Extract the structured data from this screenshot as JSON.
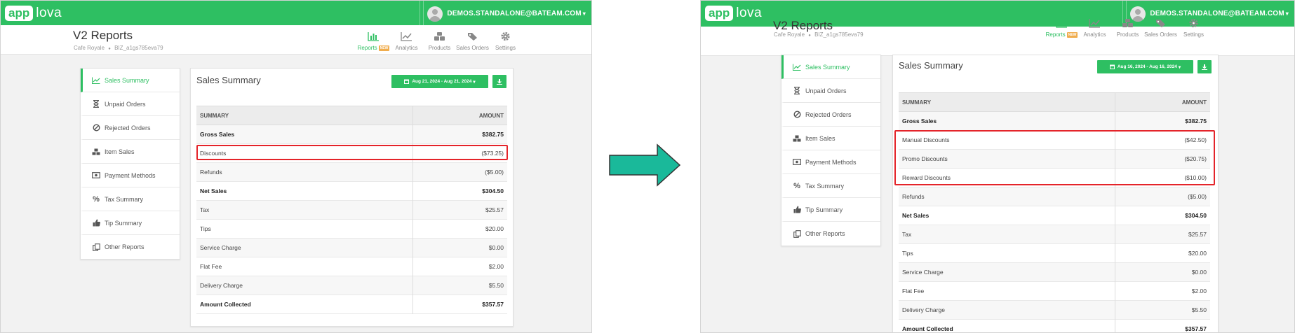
{
  "colors": {
    "brand": "#2ebf62",
    "highlight": "#e4242a",
    "arrow": "#1ab99a"
  },
  "app": {
    "logo_part1": "app",
    "logo_part2": "lova",
    "user_email": "DEMOS.STANDALONE@BATEAM.COM"
  },
  "header": {
    "title": "V2 Reports",
    "store": "Cafe Royale",
    "store_id": "BIZ_a1gs785eva79",
    "bullet": "●"
  },
  "nav": [
    {
      "label": "Reports",
      "badge": "NEW",
      "icon": "bar-chart-icon"
    },
    {
      "label": "Analytics",
      "icon": "line-chart-icon"
    },
    {
      "label": "Products",
      "icon": "cubes-icon"
    },
    {
      "label": "Sales Orders",
      "icon": "tags-icon"
    },
    {
      "label": "Settings",
      "icon": "gear-icon"
    }
  ],
  "sidebar": [
    {
      "label": "Sales Summary",
      "icon": "line-chart-icon"
    },
    {
      "label": "Unpaid Orders",
      "icon": "hourglass-icon"
    },
    {
      "label": "Rejected Orders",
      "icon": "ban-icon"
    },
    {
      "label": "Item Sales",
      "icon": "cubes-icon"
    },
    {
      "label": "Payment Methods",
      "icon": "money-icon"
    },
    {
      "label": "Tax Summary",
      "icon": "percent-icon"
    },
    {
      "label": "Tip Summary",
      "icon": "thumbs-up-icon"
    },
    {
      "label": "Other Reports",
      "icon": "copy-icon"
    }
  ],
  "before": {
    "panel_title": "Sales Summary",
    "date_range": "Aug 21, 2024 - Aug 21, 2024",
    "columns": [
      "SUMMARY",
      "AMOUNT"
    ],
    "rows": [
      {
        "label": "Gross Sales",
        "amount": "$382.75",
        "bold": true
      },
      {
        "label": "Discounts",
        "amount": "($73.25)"
      },
      {
        "label": "Refunds",
        "amount": "($5.00)"
      },
      {
        "label": "Net Sales",
        "amount": "$304.50",
        "bold": true
      },
      {
        "label": "Tax",
        "amount": "$25.57"
      },
      {
        "label": "Tips",
        "amount": "$20.00"
      },
      {
        "label": "Service Charge",
        "amount": "$0.00"
      },
      {
        "label": "Flat Fee",
        "amount": "$2.00"
      },
      {
        "label": "Delivery Charge",
        "amount": "$5.50"
      },
      {
        "label": "Amount Collected",
        "amount": "$357.57",
        "bold": true
      }
    ]
  },
  "after": {
    "panel_title": "Sales Summary",
    "date_range": "Aug 16, 2024 - Aug 16, 2024",
    "columns": [
      "SUMMARY",
      "AMOUNT"
    ],
    "rows": [
      {
        "label": "Gross Sales",
        "amount": "$382.75",
        "bold": true
      },
      {
        "label": "Manual Discounts",
        "amount": "($42.50)"
      },
      {
        "label": "Promo Discounts",
        "amount": "($20.75)"
      },
      {
        "label": "Reward Discounts",
        "amount": "($10.00)"
      },
      {
        "label": "Refunds",
        "amount": "($5.00)"
      },
      {
        "label": "Net Sales",
        "amount": "$304.50",
        "bold": true
      },
      {
        "label": "Tax",
        "amount": "$25.57"
      },
      {
        "label": "Tips",
        "amount": "$20.00"
      },
      {
        "label": "Service Charge",
        "amount": "$0.00"
      },
      {
        "label": "Flat Fee",
        "amount": "$2.00"
      },
      {
        "label": "Delivery Charge",
        "amount": "$5.50"
      },
      {
        "label": "Amount Collected",
        "amount": "$357.57",
        "bold": true
      }
    ]
  }
}
